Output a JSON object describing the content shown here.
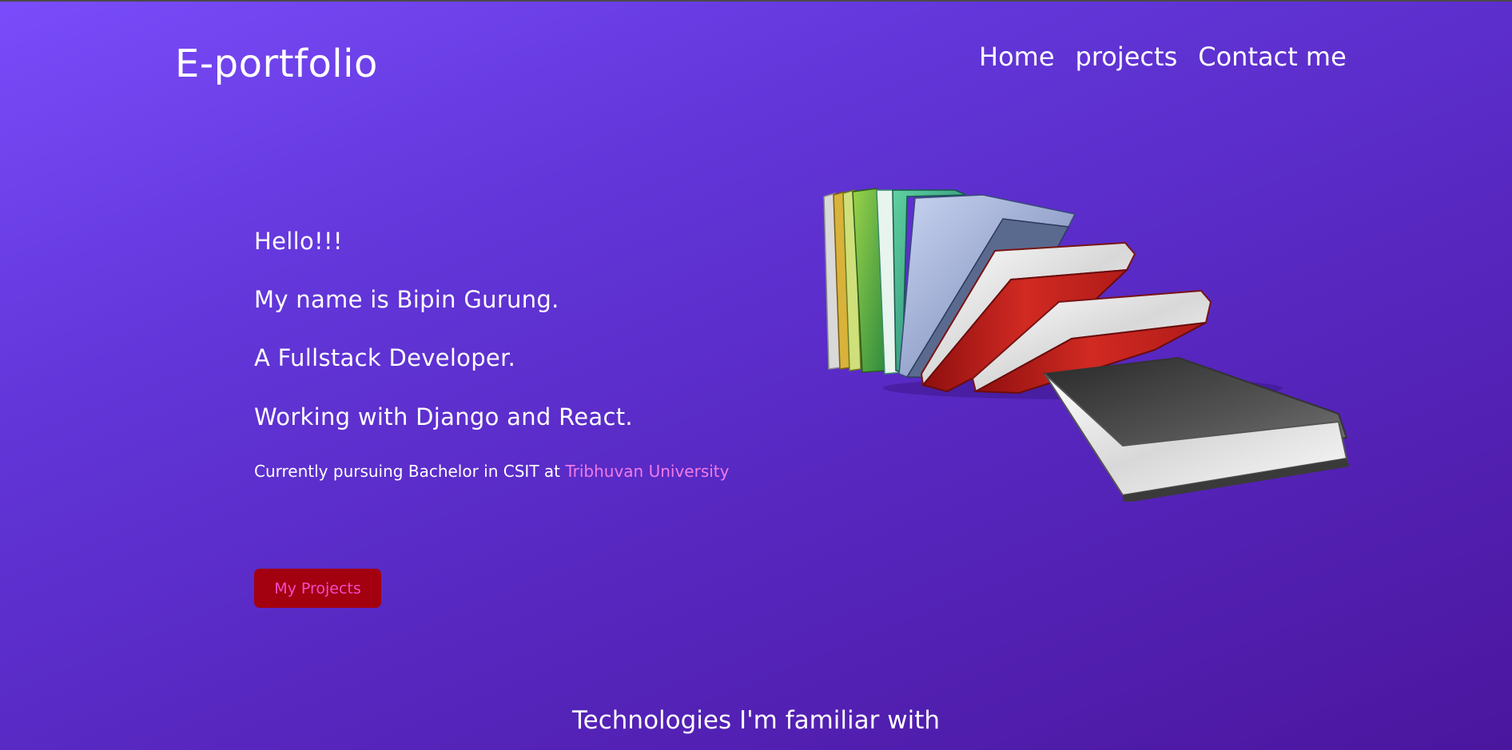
{
  "header": {
    "brand": "E-portfolio",
    "nav": [
      "Home",
      "projects",
      "Contact me"
    ]
  },
  "hero": {
    "greeting": "Hello!!!",
    "name_line": "My name is Bipin Gurung.",
    "role_line": "A Fullstack Developer.",
    "stack_line": "Working with Django and React.",
    "study_text": "Currently pursuing Bachelor in CSIT at ",
    "university": "Tribhuvan University",
    "cta_label": "My Projects",
    "image_icon": "books-illustration"
  },
  "technologies": {
    "title": "Technologies I'm familiar with"
  },
  "colors": {
    "background_start": "#7a4cfb",
    "background_end": "#4b169e",
    "university_link": "#f07ce8",
    "button_bg": "#a30010",
    "button_text": "#f34bc7"
  }
}
